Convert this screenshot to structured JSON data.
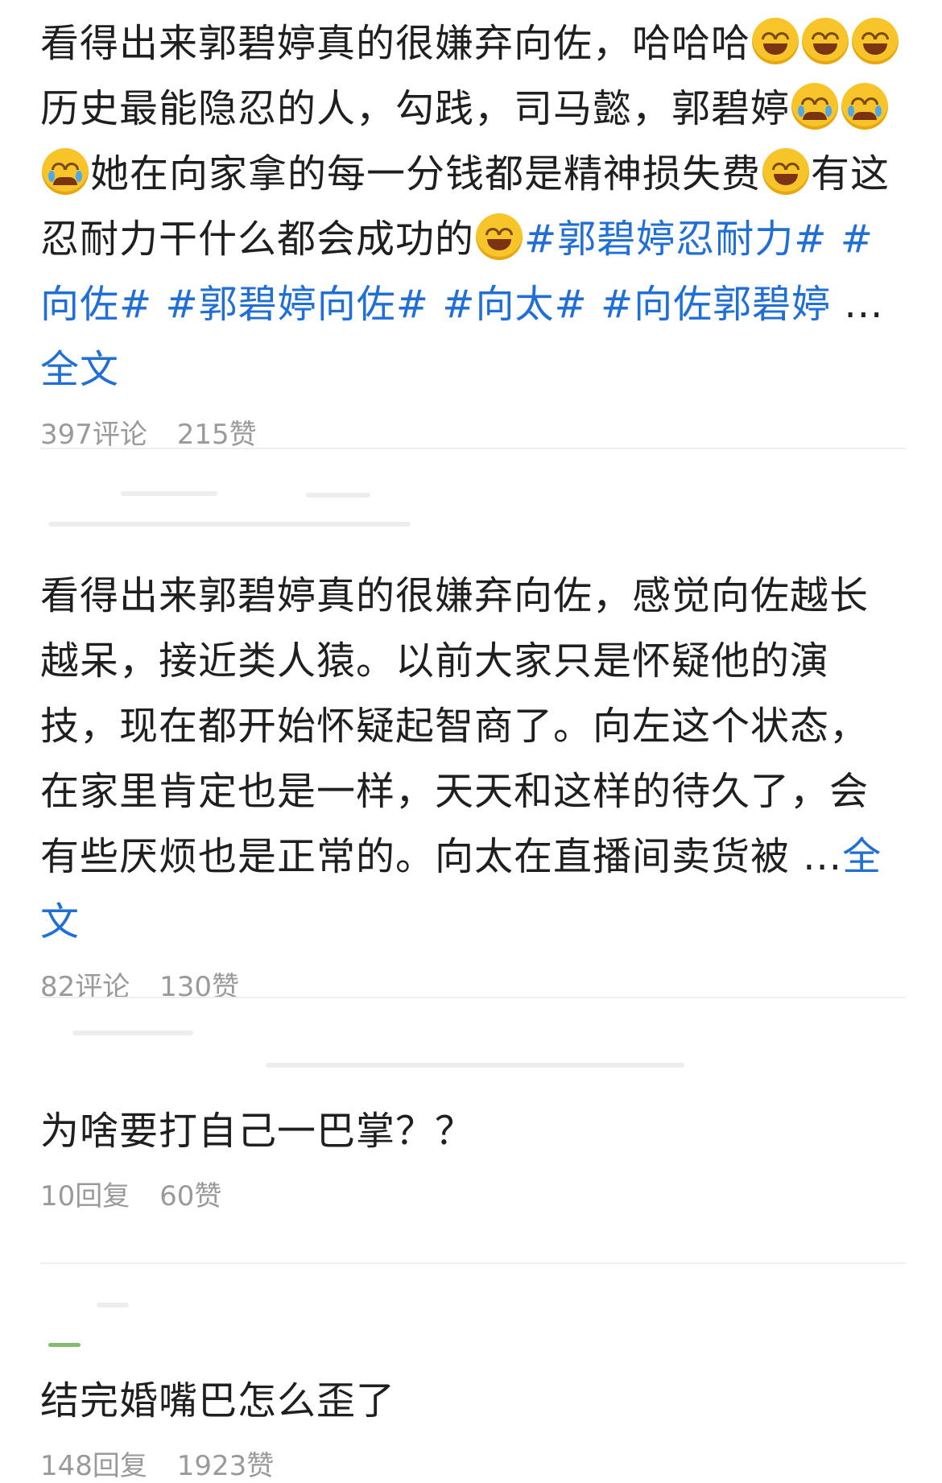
{
  "posts": [
    {
      "text_1": "看得出来郭碧婷真的很嫌弃向佐，哈哈哈",
      "text_2": "历史最能隐忍的人，勾践，司马懿，郭碧婷",
      "text_3": "她在向家拿的每一分钱都是精神损失费",
      "text_4": "有这忍耐力干什么都会成功的",
      "tags": [
        "#郭碧婷忍耐力#",
        "#向佐#",
        "#郭碧婷向佐#",
        "#向太#",
        "#向佐郭碧婷"
      ],
      "ellipsis": "...",
      "full_label": "全文",
      "comments": "397评论",
      "likes": "215赞"
    },
    {
      "text": "看得出来郭碧婷真的很嫌弃向佐，感觉向佐越长越呆，接近类人猿。以前大家只是怀疑他的演技，现在都开始怀疑起智商了。向左这个状态，在家里肯定也是一样，天天和这样的待久了，会有些厌烦也是正常的。向太在直播间卖货被",
      "ellipsis": "...",
      "full_label": "全文",
      "comments": "82评论",
      "likes": "130赞"
    },
    {
      "text": "为啥要打自己一巴掌？？",
      "replies": "10回复",
      "likes": "60赞"
    },
    {
      "text": "结完婚嘴巴怎么歪了",
      "replies": "148回复",
      "likes": "1923赞"
    }
  ],
  "icons": [
    "laughing-tears-emoji",
    "crying-emoji",
    "facepalm-laugh-emoji"
  ],
  "colors": {
    "link": "#1f6fd6",
    "meta": "#9a9a9a",
    "divider": "#eeeeee"
  }
}
